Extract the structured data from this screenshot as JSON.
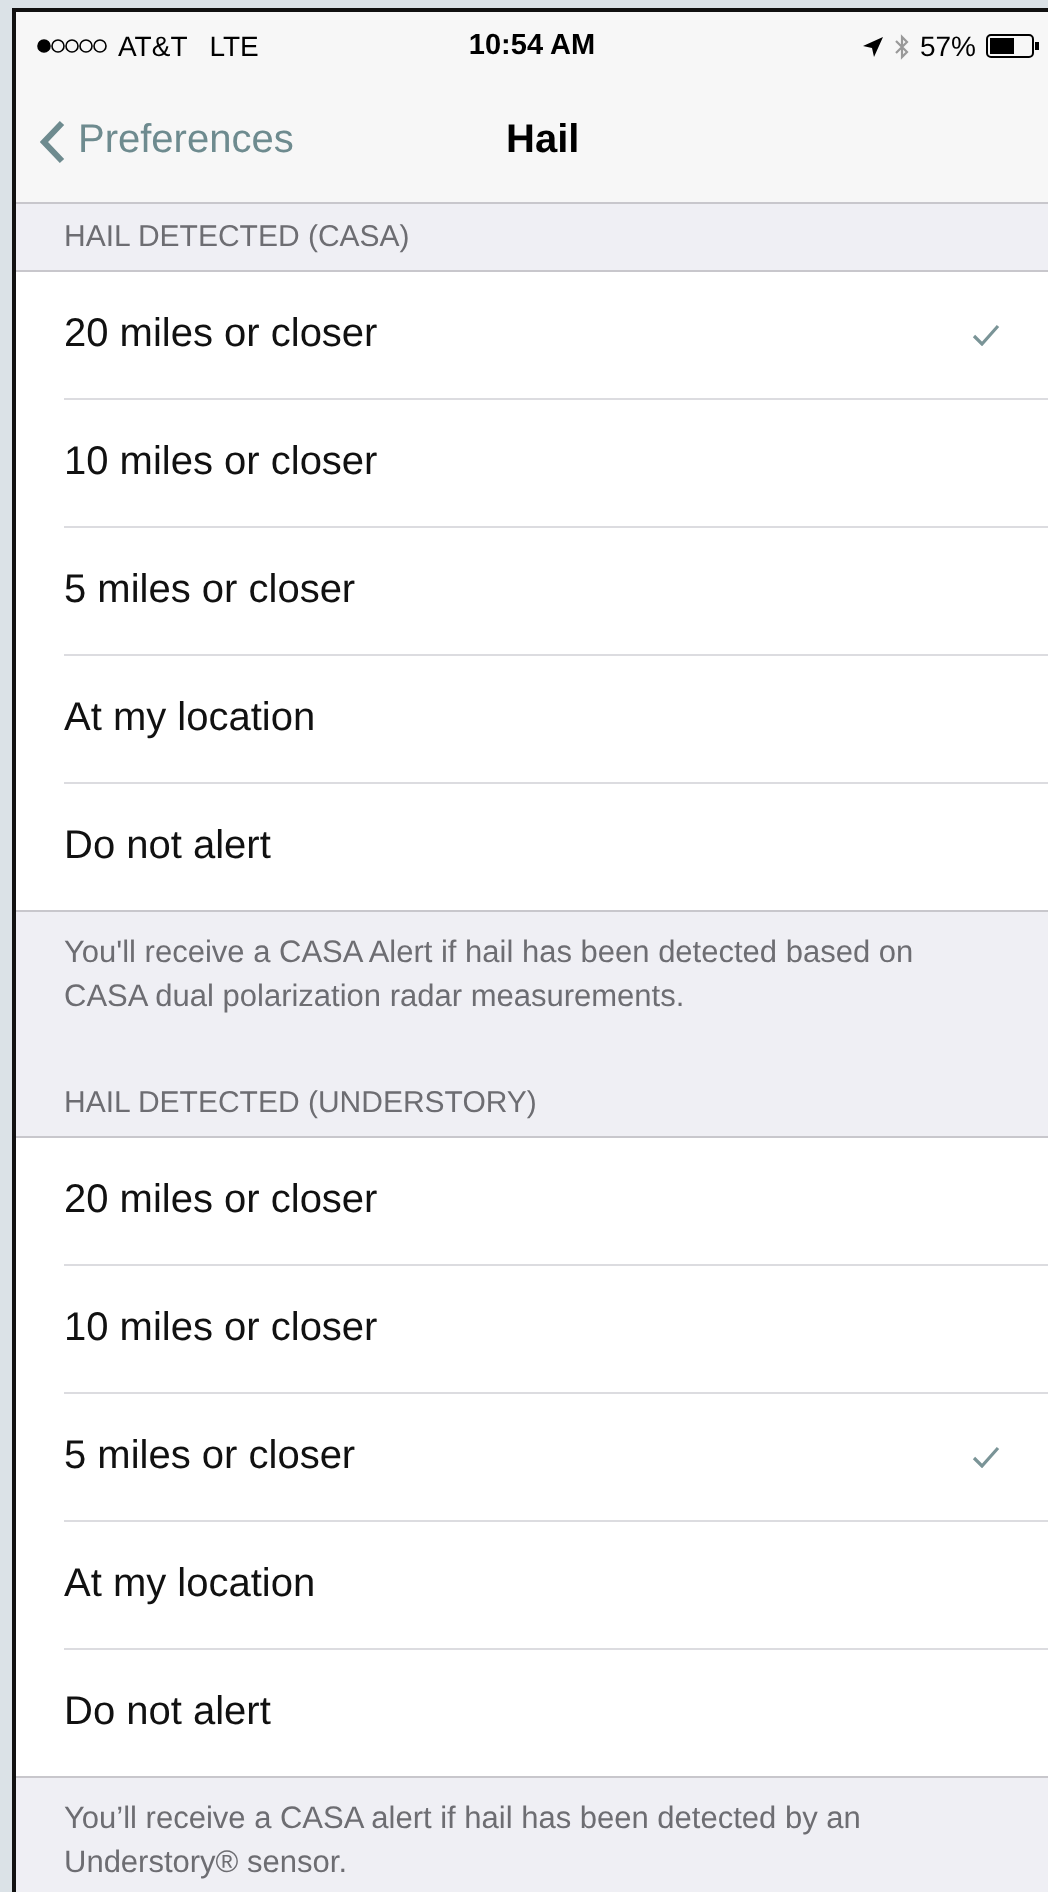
{
  "status_bar": {
    "carrier": "AT&T",
    "network": "LTE",
    "time": "10:54 AM",
    "battery": "57%"
  },
  "nav": {
    "back": "Preferences",
    "title": "Hail"
  },
  "sections": [
    {
      "header": "HAIL DETECTED (CASA)",
      "options": [
        {
          "label": "20 miles or closer",
          "selected": true
        },
        {
          "label": "10 miles or closer",
          "selected": false
        },
        {
          "label": "5 miles or closer",
          "selected": false
        },
        {
          "label": "At my location",
          "selected": false
        },
        {
          "label": "Do not alert",
          "selected": false
        }
      ],
      "footer": "You'll receive a CASA Alert if hail has been detected based on CASA dual polarization radar measurements."
    },
    {
      "header": "HAIL DETECTED (UNDERSTORY)",
      "options": [
        {
          "label": "20 miles or closer",
          "selected": false
        },
        {
          "label": "10 miles or closer",
          "selected": false
        },
        {
          "label": "5 miles or closer",
          "selected": true
        },
        {
          "label": "At my location",
          "selected": false
        },
        {
          "label": "Do not alert",
          "selected": false
        }
      ],
      "footer": "You’ll receive a CASA alert if hail has been detected by an Understory® sensor."
    }
  ]
}
